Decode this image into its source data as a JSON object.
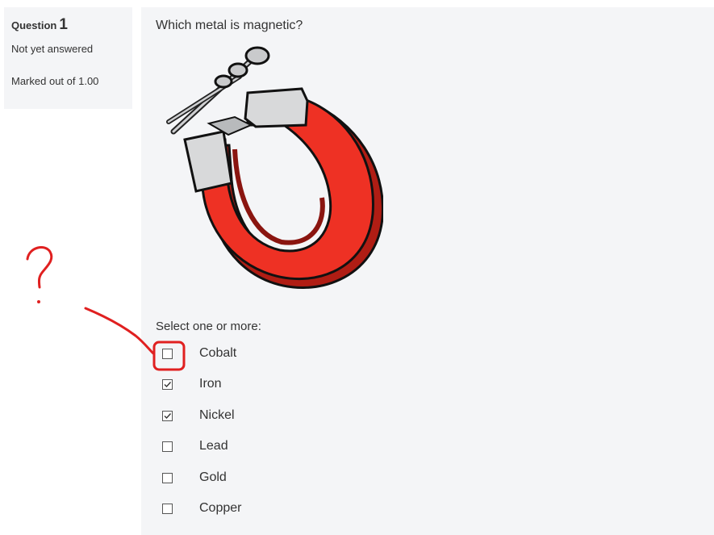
{
  "question_info": {
    "label": "Question",
    "number": "1",
    "state": "Not yet answered",
    "grade": "Marked out of 1.00"
  },
  "question": {
    "text": "Which metal is magnetic?",
    "image_icon": "horseshoe-magnet-with-nails",
    "prompt": "Select one or more:",
    "options": [
      {
        "label": "Cobalt",
        "checked": false
      },
      {
        "label": "Iron",
        "checked": true
      },
      {
        "label": "Nickel",
        "checked": true
      },
      {
        "label": "Lead",
        "checked": false
      },
      {
        "label": "Gold",
        "checked": false
      },
      {
        "label": "Copper",
        "checked": false
      }
    ]
  },
  "annotation": {
    "text": "?",
    "color": "#e02020"
  },
  "colors": {
    "panel_bg": "#f4f5f7",
    "magnet_red": "#ee3124",
    "magnet_silver": "#d8d9da"
  }
}
